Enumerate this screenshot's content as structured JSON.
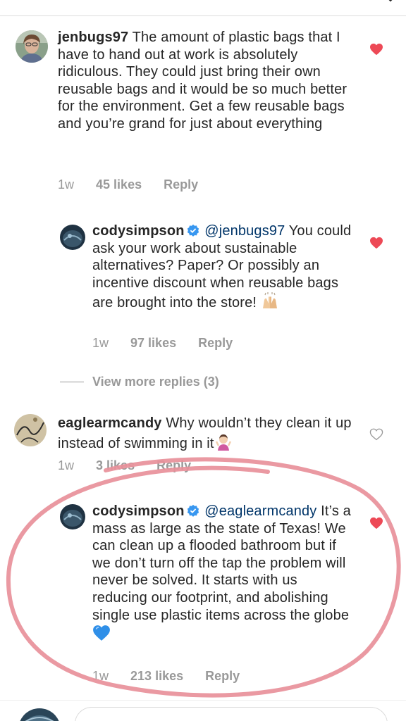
{
  "comments": [
    {
      "username": "jenbugs97",
      "text": "The amount of plastic bags that I have to hand out at work is absolutely ridiculous. They could just bring their own reusable bags and it would be so much better for the environment. Get a few reusable bags and you’re grand for just about everything",
      "time": "1w",
      "likes": "45 likes",
      "reply_label": "Reply",
      "liked": true
    },
    {
      "username": "codysimpson",
      "verified": true,
      "mention": "@jenbugs97",
      "text": "You could ask your work about sustainable alternatives? Paper? Or possibly an incentive discount when reusable bags are brought into the store!",
      "emoji": "raising-hands",
      "time": "1w",
      "likes": "97 likes",
      "reply_label": "Reply",
      "liked": true
    },
    {
      "username": "eaglearmcandy",
      "text": "Why wouldn’t they clean it up instead of swimming in it",
      "emoji": "person-shrugging",
      "time": "1w",
      "likes": "3 likes",
      "reply_label": "Reply",
      "liked": false
    },
    {
      "username": "codysimpson",
      "verified": true,
      "mention": "@eaglearmcandy",
      "text": "It’s a mass as large as the state of Texas! We can clean up a flooded bathroom but if we don’t turn off the tap the problem will never be solved. It starts with us reducing our footprint, and abolishing single use plastic items across the globe",
      "emoji": "blue-heart",
      "time": "1w",
      "likes": "213 likes",
      "reply_label": "Reply",
      "liked": true
    }
  ],
  "view_more_replies": "View more replies (3)",
  "colors": {
    "text": "#262626",
    "meta": "#999999",
    "heart_liked": "#ed4956",
    "verified_badge": "#3897f0",
    "mention": "#003569",
    "annotation_circle": "#e8909a"
  },
  "icons": [
    "heart-icon",
    "verified-badge-icon",
    "chevron-down-icon"
  ]
}
